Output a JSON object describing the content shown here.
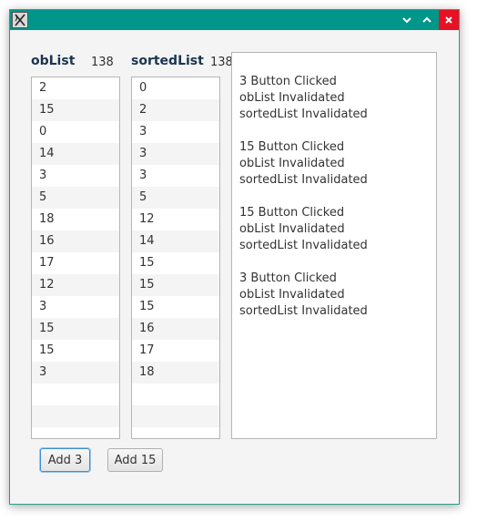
{
  "window": {
    "title": ""
  },
  "oblist": {
    "label": "obList",
    "count": "138",
    "items": [
      "2",
      "15",
      "0",
      "14",
      "3",
      "5",
      "18",
      "16",
      "17",
      "12",
      "3",
      "15",
      "15",
      "3"
    ]
  },
  "sortedlist": {
    "label": "sortedList",
    "count": "138",
    "items": [
      "0",
      "2",
      "3",
      "3",
      "3",
      "5",
      "12",
      "14",
      "15",
      "15",
      "15",
      "16",
      "17",
      "18"
    ]
  },
  "log": {
    "lines": [
      "3 Button Clicked",
      "obList Invalidated",
      "sortedList Invalidated",
      "",
      "15 Button Clicked",
      "obList Invalidated",
      "sortedList Invalidated",
      "",
      "15 Button Clicked",
      "obList Invalidated",
      "sortedList Invalidated",
      "",
      "3 Button Clicked",
      "obList Invalidated",
      "sortedList Invalidated"
    ]
  },
  "buttons": {
    "add3": "Add 3",
    "add15": "Add 15"
  },
  "icons": {
    "app": "app-icon",
    "minimize": "chevron-down-icon",
    "maximize": "chevron-up-icon",
    "close": "close-icon"
  },
  "colors": {
    "titlebar": "#00968a",
    "close": "#e81123",
    "header_text": "#1b3550",
    "focus": "#3c8fd0"
  }
}
